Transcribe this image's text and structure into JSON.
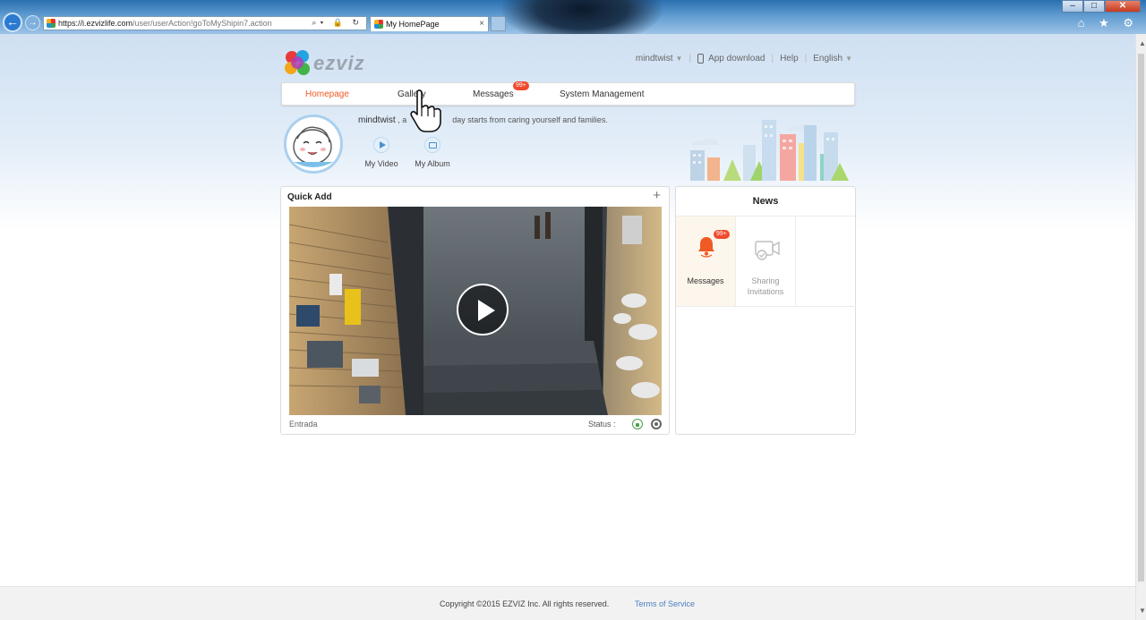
{
  "browser": {
    "url_main": "https://i.ezvizlife.com",
    "url_path": "/user/userAction!goToMyShipin7.action",
    "tab_title": "My HomePage",
    "tab_close": "×",
    "window_min": "–",
    "window_max": "□",
    "window_close": "✕",
    "right_icons": "⌂ ★ ⚙",
    "addr_controls": "⌕▾ 🔒 ↻"
  },
  "header": {
    "logo_text": "ezviz",
    "username": "mindtwist",
    "app_download": "App download",
    "help": "Help",
    "language": "English"
  },
  "nav": {
    "items": [
      {
        "label": "Homepage",
        "active": true
      },
      {
        "label": "Gallery",
        "active": false
      },
      {
        "label": "Messages",
        "active": false
      },
      {
        "label": "System Management",
        "active": false
      }
    ],
    "messages_badge": "99+"
  },
  "profile": {
    "username": "mindtwist",
    "tagline_prefix": ", a",
    "tagline_suffix": "day starts from caring yourself and families.",
    "my_video": "My Video",
    "my_album": "My Album"
  },
  "quick_add": {
    "title": "Quick Add",
    "add_symbol": "+",
    "camera_name": "Entrada",
    "status_label": "Status :"
  },
  "news": {
    "title": "News",
    "messages_label": "Messages",
    "messages_badge": "99+",
    "sharing_label_1": "Sharing",
    "sharing_label_2": "Invitations"
  },
  "footer": {
    "copyright": "Copyright ©2015 EZVIZ Inc. All rights reserved.",
    "terms": "Terms of Service"
  },
  "colors": {
    "accent": "#f05a24",
    "badge": "#f04a2c",
    "link": "#4a7ec2"
  }
}
